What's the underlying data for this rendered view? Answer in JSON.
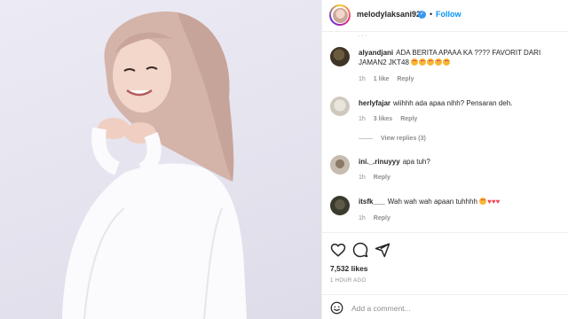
{
  "post": {
    "username": "melodylaksani92",
    "verified_icon": "verified-badge-icon",
    "separator": "•",
    "follow_label": "Follow"
  },
  "comments": [
    {
      "username": "alyandjani",
      "text": "ADA BERITA APAAA KA ???? FAVORIT DARI JAMAN2 JKT48",
      "emojis": [
        "heart-eyes-face-icon",
        "heart-eyes-face-icon",
        "heart-eyes-face-icon",
        "heart-eyes-face-icon",
        "heart-eyes-face-icon"
      ],
      "time": "1h",
      "likes": "1 like",
      "reply_label": "Reply"
    },
    {
      "username": "herlyfajar",
      "text": "wiihhh ada apaa nihh? Pensaran deh.",
      "time": "1h",
      "likes": "3 likes",
      "reply_label": "Reply",
      "view_replies": "View replies (3)"
    },
    {
      "username": "ini._.rinuyyy",
      "text": "apa tuh?",
      "time": "1h",
      "reply_label": "Reply"
    },
    {
      "username": "itsfk___",
      "text": "Wah wah wah apaan tuhhhh",
      "emojis": [
        "heart-eyes-face-icon",
        "heart-icon",
        "heart-icon",
        "heart-icon"
      ],
      "time": "1h",
      "reply_label": "Reply"
    }
  ],
  "actions": {
    "like_icon": "heart-outline-icon",
    "comment_icon": "comment-bubble-icon",
    "share_icon": "paper-plane-icon"
  },
  "likes_count": "7,532 likes",
  "time_ago": "1 HOUR AGO",
  "add_comment": {
    "emoji_icon": "smiley-icon",
    "placeholder": "Add a comment..."
  },
  "colors": {
    "accent": "#0095f6",
    "verified": "#3897f0",
    "muted": "#8e8e8e",
    "heart": "#ed4956"
  }
}
